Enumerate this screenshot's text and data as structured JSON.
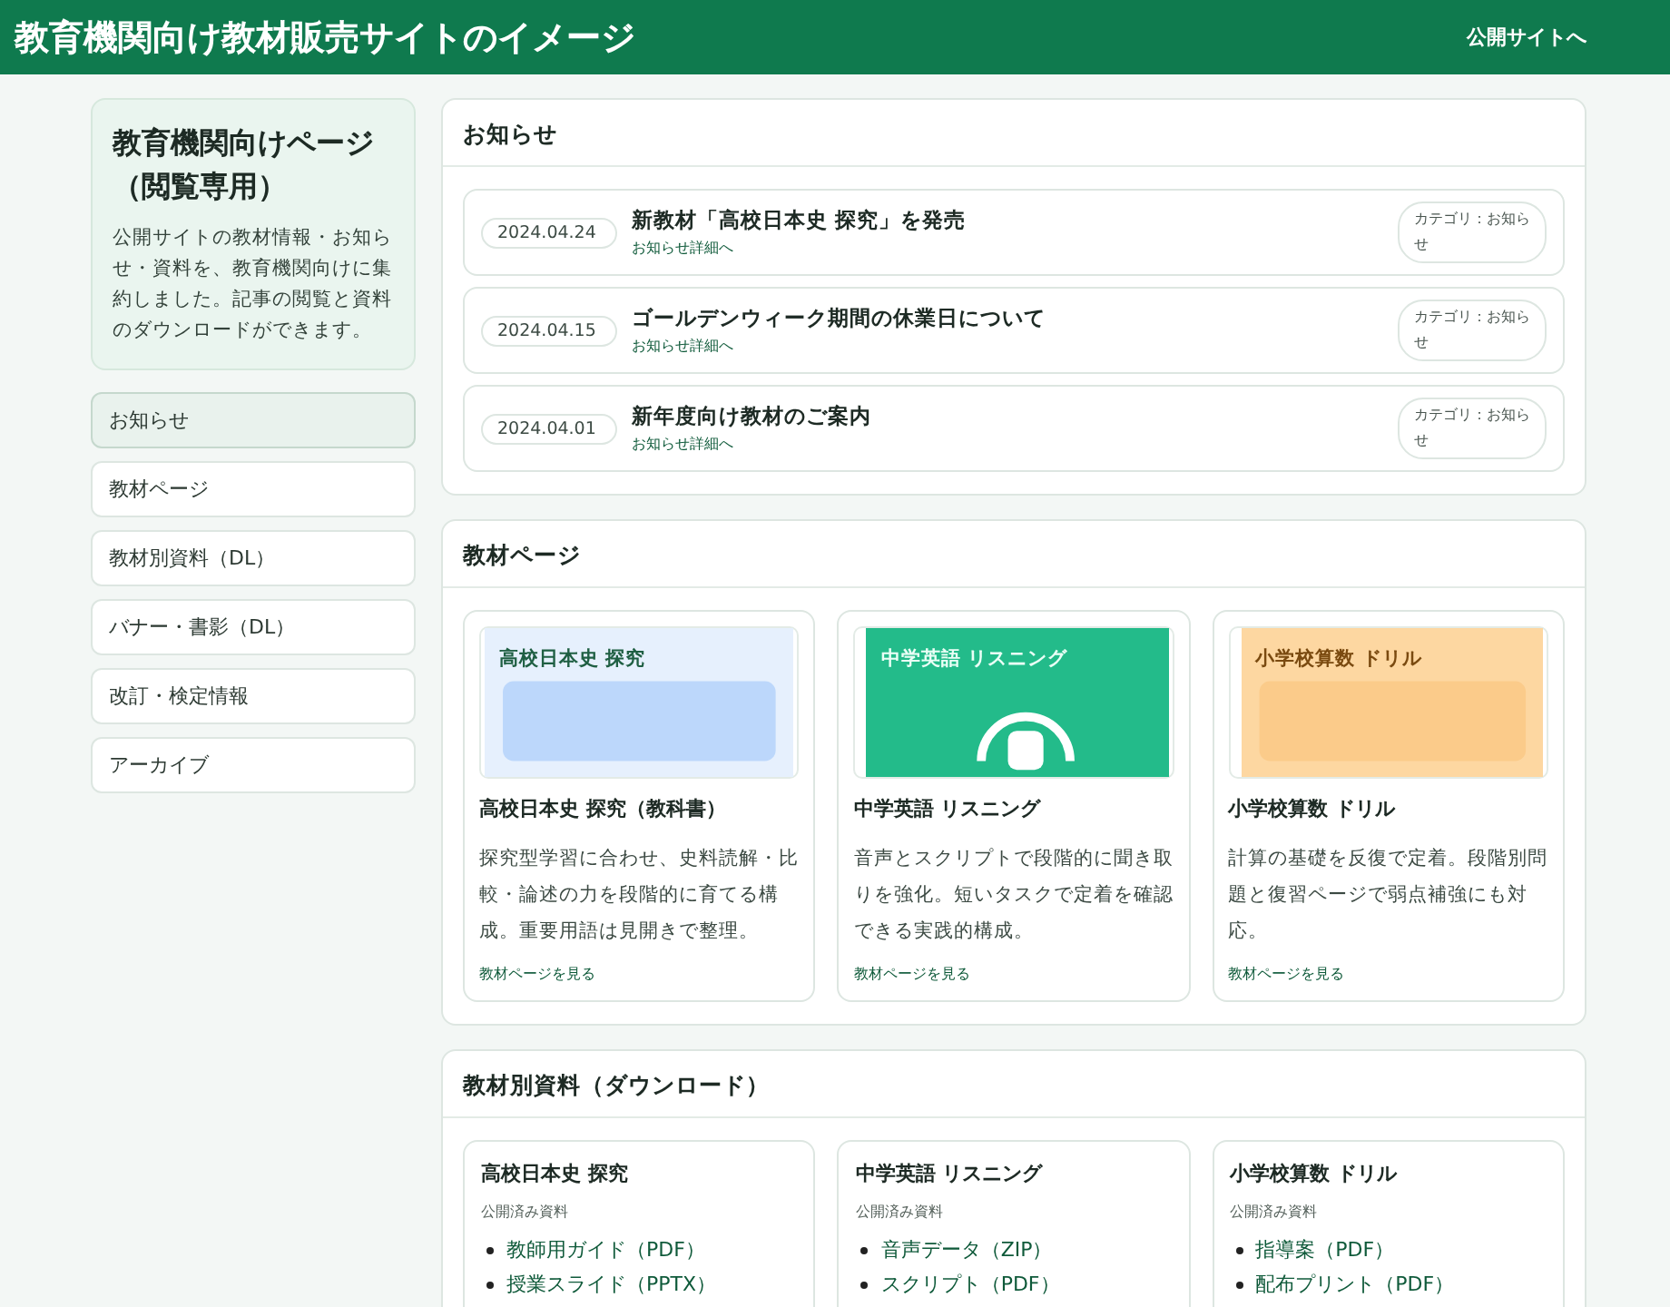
{
  "header": {
    "title": "教育機関向け教材販売サイトのイメージ",
    "link": "公開サイトへ"
  },
  "sidebar": {
    "title": "教育機関向けページ（閲覧専用）",
    "description": "公開サイトの教材情報・お知らせ・資料を、教育機関向けに集約しました。記事の閲覧と資料のダウンロードができます。",
    "items": [
      {
        "label": "お知らせ",
        "selected": true
      },
      {
        "label": "教材ページ",
        "selected": false
      },
      {
        "label": "教材別資料（DL）",
        "selected": false
      },
      {
        "label": "バナー・書影（DL）",
        "selected": false
      },
      {
        "label": "改訂・検定情報",
        "selected": false
      },
      {
        "label": "アーカイブ",
        "selected": false
      }
    ]
  },
  "news": {
    "heading": "お知らせ",
    "items": [
      {
        "date": "2024.04.24",
        "title": "新教材「高校日本史 探究」を発売",
        "link": "お知らせ詳細へ",
        "category": "カテゴリ：お知らせ"
      },
      {
        "date": "2024.04.15",
        "title": "ゴールデンウィーク期間の休業日について",
        "link": "お知らせ詳細へ",
        "category": "カテゴリ：お知らせ"
      },
      {
        "date": "2024.04.01",
        "title": "新年度向け教材のご案内",
        "link": "お知らせ詳細へ",
        "category": "カテゴリ：お知らせ"
      }
    ]
  },
  "materials": {
    "heading": "教材ページ",
    "items": [
      {
        "kind": "book",
        "banner": "高校日本史 探究",
        "title": "高校日本史 探究（教科書）",
        "description": "探究型学習に合わせ、史料読解・比較・論述の力を段階的に育てる構成。重要用語は見開きで整理。",
        "link": "教材ページを見る"
      },
      {
        "kind": "audio",
        "banner": "中学英語 リスニング",
        "title": "中学英語 リスニング",
        "description": "音声とスクリプトで段階的に聞き取りを強化。短いタスクで定着を確認できる実践的構成。",
        "link": "教材ページを見る"
      },
      {
        "kind": "drill",
        "banner": "小学校算数 ドリル",
        "title": "小学校算数 ドリル",
        "description": "計算の基礎を反復で定着。段階別問題と復習ページで弱点補強にも対応。",
        "link": "教材ページを見る"
      }
    ]
  },
  "downloads": {
    "heading": "教材別資料（ダウンロード）",
    "items": [
      {
        "title": "高校日本史 探究",
        "subtitle": "公開済み資料",
        "files": [
          "教師用ガイド（PDF）",
          "授業スライド（PPTX）"
        ]
      },
      {
        "title": "中学英語 リスニング",
        "subtitle": "公開済み資料",
        "files": [
          "音声データ（ZIP）",
          "スクリプト（PDF）"
        ]
      },
      {
        "title": "小学校算数 ドリル",
        "subtitle": "公開済み資料",
        "files": [
          "指導案（PDF）",
          "配布プリント（PDF）"
        ]
      }
    ]
  }
}
